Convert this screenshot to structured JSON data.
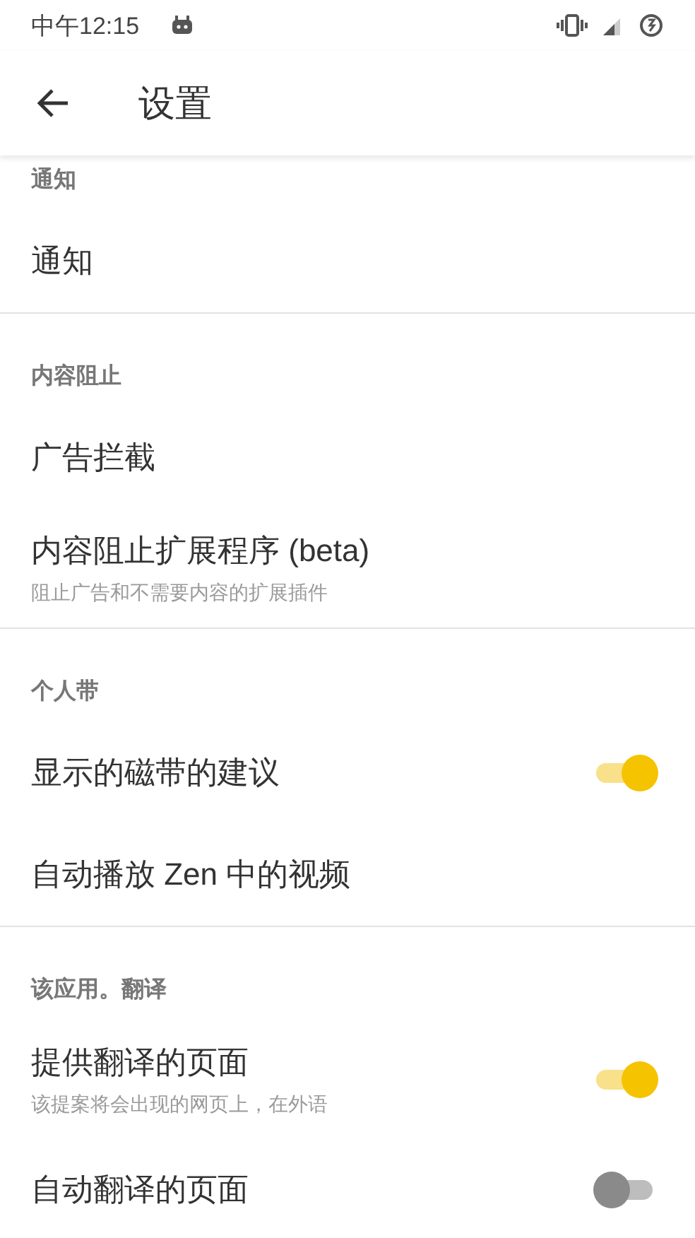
{
  "status_bar": {
    "time": "中午12:15"
  },
  "toolbar": {
    "title": "设置"
  },
  "sections": [
    {
      "header": "通知",
      "items": [
        {
          "kind": "plain",
          "title": "通知"
        }
      ]
    },
    {
      "header": "内容阻止",
      "items": [
        {
          "kind": "plain",
          "title": "广告拦截"
        },
        {
          "kind": "plain",
          "title": "内容阻止扩展程序 (beta)",
          "subtitle": "阻止广告和不需要内容的扩展插件"
        }
      ]
    },
    {
      "header": "个人带",
      "items": [
        {
          "kind": "toggle",
          "title": "显示的磁带的建议",
          "on": true
        },
        {
          "kind": "plain",
          "title": "自动播放 Zen 中的视频"
        }
      ]
    },
    {
      "header": "该应用。翻译",
      "items": [
        {
          "kind": "toggle",
          "title": "提供翻译的页面",
          "subtitle": "该提案将会出现的网页上，在外语",
          "on": true
        },
        {
          "kind": "toggle",
          "title": "自动翻译的页面",
          "on": false
        }
      ]
    }
  ]
}
